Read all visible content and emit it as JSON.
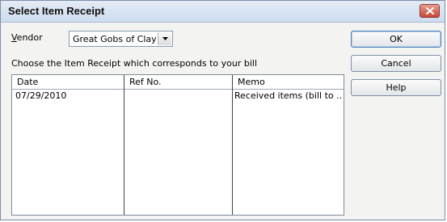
{
  "window": {
    "title": "Select Item Receipt"
  },
  "vendor": {
    "label_prefix": "V",
    "label_rest": "endor",
    "value": "Great Gobs of Clay"
  },
  "instruction": "Choose the Item Receipt which corresponds to your bill",
  "table": {
    "columns": [
      "Date",
      "Ref No.",
      "Memo"
    ],
    "rows": [
      {
        "date": "07/29/2010",
        "ref_no": "",
        "memo": "Received items (bill to ..."
      }
    ]
  },
  "buttons": {
    "ok": "OK",
    "cancel": "Cancel",
    "help": "Help"
  },
  "colors": {
    "title_bar": "#d6e2f1",
    "close_button": "#d35a4a",
    "dialog_bg": "#f3f3f1"
  }
}
